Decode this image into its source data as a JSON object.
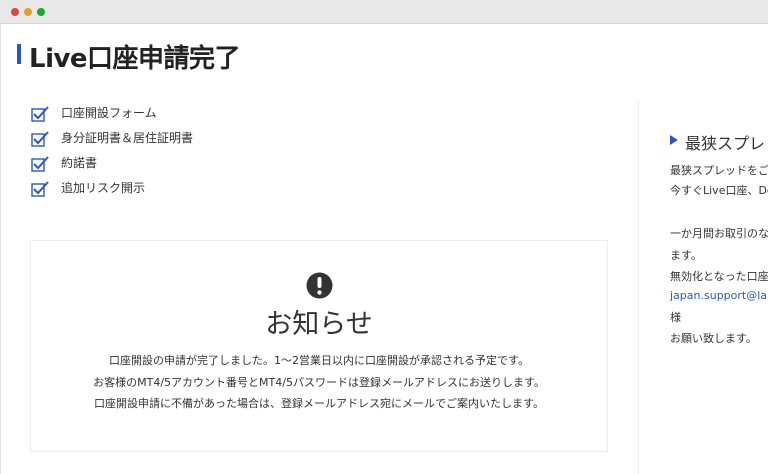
{
  "window": {
    "controls": [
      "close",
      "minimize",
      "maximize"
    ]
  },
  "page": {
    "title": "Live口座申請完了"
  },
  "checklist": [
    {
      "label": "口座開設フォーム",
      "icon": "checkbox-checked-icon"
    },
    {
      "label": "身分証明書＆居住証明書",
      "icon": "checkbox-checked-icon"
    },
    {
      "label": "約諾書",
      "icon": "checkbox-checked-icon"
    },
    {
      "label": "追加リスク開示",
      "icon": "checkbox-checked-icon"
    }
  ],
  "notice": {
    "icon": "exclamation-circle-icon",
    "title": "お知らせ",
    "lines": [
      "口座開設の申請が完了しました。1〜2営業日以内に口座開設が承認される予定です。",
      "お客様のMT4/5アカウント番号とMT4/5パスワードは登録メールアドレスにお送りします。",
      "口座開設申請に不備があった場合は、登録メールアドレス宛にメールでご案内いたします。"
    ]
  },
  "sidebar": {
    "heading": "最狭スプレッ",
    "lines": [
      "最狭スプレッドをご提",
      "今すぐLive口座、De",
      "一か月間お取引のな",
      "ます。",
      "無効化となった口座",
      "japan.support@lan",
      "様",
      "お願い致します。"
    ]
  },
  "colors": {
    "accent": "#2b56c9",
    "text": "#333333",
    "border": "#ececec"
  }
}
